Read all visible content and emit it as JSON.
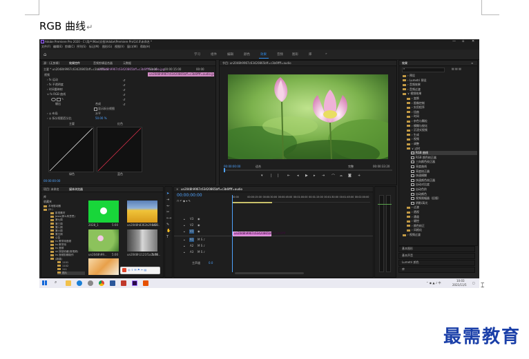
{
  "doc": {
    "heading": "RGB 曲线",
    "para_mark": "↵",
    "watermark": "最需教育"
  },
  "app": {
    "title": "Adobe Premiere Pro 2020 - C:\\用户\\Max\\文档\\Adobe\\Premiere Pro\\14.0\\未命名 *",
    "win_min": "—",
    "win_max": "▫",
    "win_close": "✕",
    "menu": [
      "文件(F)",
      "编辑(E)",
      "剪辑(C)",
      "序列(S)",
      "标记(M)",
      "图形(G)",
      "视图(V)",
      "窗口(W)",
      "帮助(H)"
    ],
    "workspaces": [
      "学习",
      "组件",
      "编辑",
      "颜色",
      "效果",
      "音频",
      "图形",
      "库"
    ],
    "active_workspace": "效果"
  },
  "effect_controls": {
    "tabs": [
      "源：(无剪辑)",
      "效果控件",
      "音频剪辑混合器",
      "元数据"
    ],
    "master_clip": "主要 * un2048h9967c63420865bff=c3b6ffff=a",
    "sequence_clip": "un2048h9967c63420865bff=c3b6ffff=audio.jpg",
    "timecodes": [
      "00:00",
      "00:00:15:00",
      "00:00"
    ],
    "rows": [
      {
        "label": "视频",
        "value": ""
      },
      {
        "label": "› fx 运动",
        "value": ""
      },
      {
        "label": "› fx 不透明度",
        "value": ""
      },
      {
        "label": "› 时间重映射",
        "value": ""
      },
      {
        "label": "∨ fx RGB 曲线",
        "value": ""
      },
      {
        "label": "输出",
        "value": "合成"
      },
      {
        "label": "",
        "value": "显示拆分视图"
      },
      {
        "label": "› ◎ 布局",
        "value": "水平"
      },
      {
        "label": "› ◎ 拆分视图百分比",
        "value": "50.00 %"
      }
    ],
    "curve_labels": [
      "主要",
      "红色",
      "绿色",
      "蓝色"
    ],
    "timecode_bottom": "00:00:00:00"
  },
  "program": {
    "title": "节目: un2048h9967c63420865bff=c3b6ffff=audio",
    "timecode_in": "00:00:00:00",
    "fit": "适合",
    "quality": "完整",
    "timecode_out": "00:00:33:20"
  },
  "project": {
    "tabs": [
      "项目: 未命名",
      "媒体浏览器"
    ],
    "bins": [
      "库",
      "收藏夹"
    ],
    "tree": [
      "本地驱动器",
      "(D:)",
      "影视素材",
      "Jews(那么有意思)",
      "第七周",
      "第三周",
      "第八周",
      "第六周",
      "第五周",
      "公告",
      "ks 教学用音频",
      "ks 教学用",
      "ks 音频",
      "sk 按钮收藏(音视频)",
      "ks 音频剪辑制作",
      "(新建)",
      "1101",
      "1102",
      "111",
      "图片"
    ],
    "thumbs": [
      {
        "name": "2028_1",
        "dur": "5:00"
      },
      {
        "name": "un2048h8362b29442...",
        "dur": "5:00"
      },
      {
        "name": "un2048h99...",
        "dur": "5:00"
      },
      {
        "name": "un2048h1121f1a2b78...",
        "dur": "5:00"
      },
      {
        "name": "",
        "dur": ""
      }
    ]
  },
  "timeline": {
    "title": "un2048h9967c63420865bff=c3b6ffff=audio",
    "timecode": "00:00:00:00",
    "ruler": [
      "00:00",
      "00:00:15:00",
      "00:00:30:00",
      "00:00:45:00",
      "00:01:00:00",
      "00:01:15:00",
      "00:01:30:00",
      "00:01:45:00",
      "00:02:00:00"
    ],
    "tracks": [
      "V3",
      "V2",
      "V1",
      "A1",
      "A2",
      "A3"
    ],
    "master": "主声道",
    "master_val": "0.0",
    "clip_label": "un2048h9967c63420865bff=c3b6ffff"
  },
  "effects_panel": {
    "title": "效果",
    "items": [
      {
        "label": "› 预设",
        "indent": 0,
        "sel": false
      },
      {
        "label": "› Lumetri 预设",
        "indent": 0,
        "sel": false
      },
      {
        "label": "› 音频效果",
        "indent": 0,
        "sel": false
      },
      {
        "label": "› 音频过渡",
        "indent": 0,
        "sel": false
      },
      {
        "label": "∨ 视频效果",
        "indent": 0,
        "sel": false
      },
      {
        "label": "› 变换",
        "indent": 1,
        "sel": false
      },
      {
        "label": "› 图像控制",
        "indent": 1,
        "sel": false
      },
      {
        "label": "› 实用程序",
        "indent": 1,
        "sel": false
      },
      {
        "label": "› 扭曲",
        "indent": 1,
        "sel": false
      },
      {
        "label": "› 时间",
        "indent": 1,
        "sel": false
      },
      {
        "label": "› 杂色与颗粒",
        "indent": 1,
        "sel": false
      },
      {
        "label": "› 模糊与锐化",
        "indent": 1,
        "sel": false
      },
      {
        "label": "› 沉浸式视频",
        "indent": 1,
        "sel": false
      },
      {
        "label": "› 生成",
        "indent": 1,
        "sel": false
      },
      {
        "label": "› 视频",
        "indent": 1,
        "sel": false
      },
      {
        "label": "› 调整",
        "indent": 1,
        "sel": false
      },
      {
        "label": "∨ 过时",
        "indent": 1,
        "sel": false
      },
      {
        "label": "RGB 曲线",
        "indent": 2,
        "sel": true
      },
      {
        "label": "RGB 颜色校正器",
        "indent": 2,
        "sel": false
      },
      {
        "label": "三向颜色校正器",
        "indent": 2,
        "sel": false
      },
      {
        "label": "亮度曲线",
        "indent": 2,
        "sel": false
      },
      {
        "label": "亮度校正器",
        "indent": 2,
        "sel": false
      },
      {
        "label": "快速模糊",
        "indent": 2,
        "sel": false
      },
      {
        "label": "快速颜色校正器",
        "indent": 2,
        "sel": false
      },
      {
        "label": "自动对比度",
        "indent": 2,
        "sel": false
      },
      {
        "label": "自动色阶",
        "indent": 2,
        "sel": false
      },
      {
        "label": "自动颜色",
        "indent": 2,
        "sel": false
      },
      {
        "label": "视频限幅器（旧版）",
        "indent": 2,
        "sel": false
      },
      {
        "label": "阴影/高光",
        "indent": 2,
        "sel": false
      },
      {
        "label": "› 过渡",
        "indent": 1,
        "sel": false
      },
      {
        "label": "› 透视",
        "indent": 1,
        "sel": false
      },
      {
        "label": "› 通道",
        "indent": 1,
        "sel": false
      },
      {
        "label": "› 键控",
        "indent": 1,
        "sel": false
      },
      {
        "label": "› 颜色校正",
        "indent": 1,
        "sel": false
      },
      {
        "label": "› 风格化",
        "indent": 1,
        "sel": false
      },
      {
        "label": "› 视频过渡",
        "indent": 0,
        "sel": false
      }
    ],
    "sub_panels": [
      "基本图形",
      "基本声音",
      "Lumetri 颜色",
      "库"
    ]
  },
  "taskbar": {
    "time": "10:03",
    "date": "2021/11/5"
  }
}
